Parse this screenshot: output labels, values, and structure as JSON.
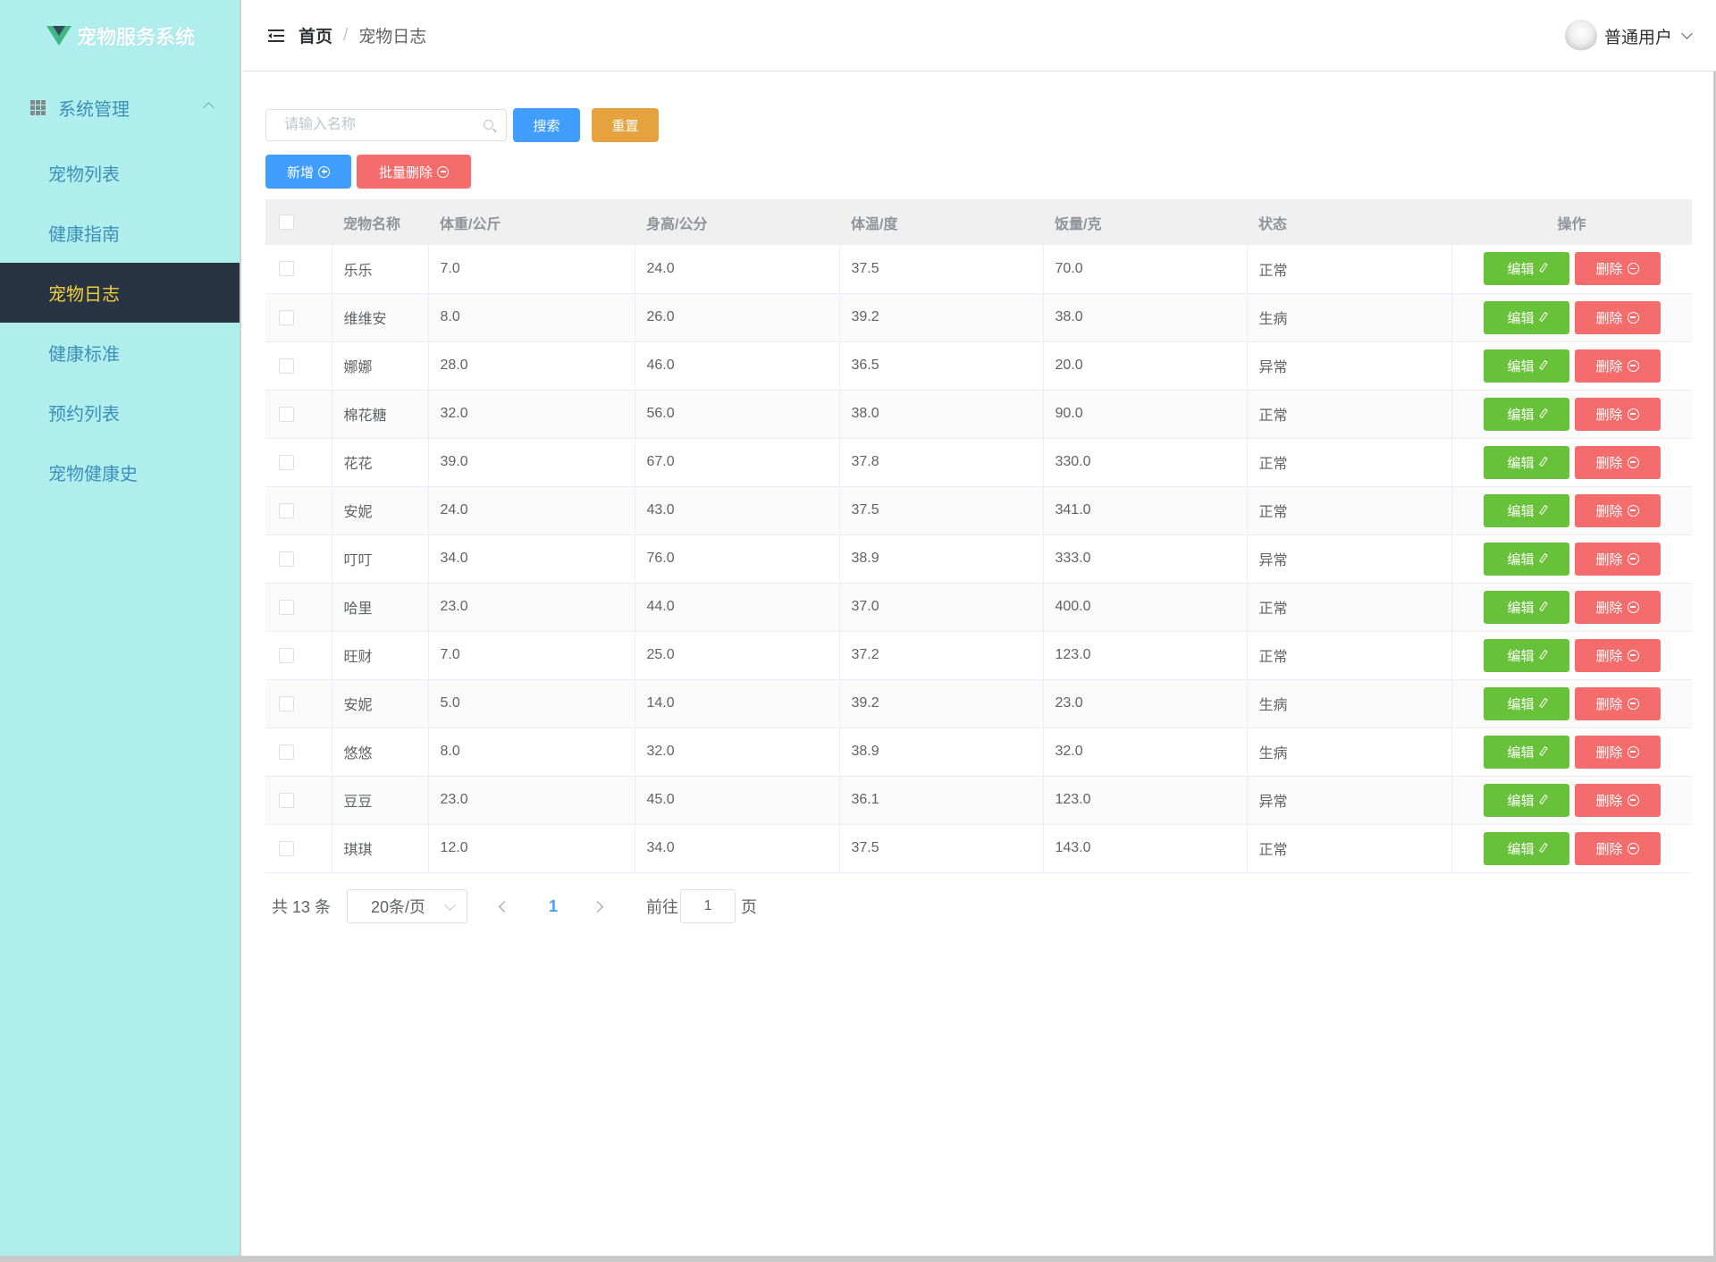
{
  "app": {
    "title": "宠物服务系统"
  },
  "sidebar": {
    "group_label": "系统管理",
    "items": [
      {
        "label": "宠物列表"
      },
      {
        "label": "健康指南"
      },
      {
        "label": "宠物日志"
      },
      {
        "label": "健康标准"
      },
      {
        "label": "预约列表"
      },
      {
        "label": "宠物健康史"
      }
    ],
    "active_index": 2
  },
  "header": {
    "breadcrumb": {
      "home": "首页",
      "separator": "/",
      "current": "宠物日志"
    },
    "user": {
      "name": "普通用户"
    }
  },
  "toolbar": {
    "search_placeholder": "请输入名称",
    "search_label": "搜索",
    "reset_label": "重置",
    "add_label": "新增",
    "batch_delete_label": "批量删除"
  },
  "table": {
    "columns": [
      "宠物名称",
      "体重/公斤",
      "身高/公分",
      "体温/度",
      "饭量/克",
      "状态",
      "操作"
    ],
    "edit_label": "编辑",
    "delete_label": "删除",
    "rows": [
      {
        "name": "乐乐",
        "weight": "7.0",
        "height": "24.0",
        "temp": "37.5",
        "food": "70.0",
        "status": "正常"
      },
      {
        "name": "维维安",
        "weight": "8.0",
        "height": "26.0",
        "temp": "39.2",
        "food": "38.0",
        "status": "生病"
      },
      {
        "name": "娜娜",
        "weight": "28.0",
        "height": "46.0",
        "temp": "36.5",
        "food": "20.0",
        "status": "异常"
      },
      {
        "name": "棉花糖",
        "weight": "32.0",
        "height": "56.0",
        "temp": "38.0",
        "food": "90.0",
        "status": "正常"
      },
      {
        "name": "花花",
        "weight": "39.0",
        "height": "67.0",
        "temp": "37.8",
        "food": "330.0",
        "status": "正常"
      },
      {
        "name": "安妮",
        "weight": "24.0",
        "height": "43.0",
        "temp": "37.5",
        "food": "341.0",
        "status": "正常"
      },
      {
        "name": "叮叮",
        "weight": "34.0",
        "height": "76.0",
        "temp": "38.9",
        "food": "333.0",
        "status": "异常"
      },
      {
        "name": "哈里",
        "weight": "23.0",
        "height": "44.0",
        "temp": "37.0",
        "food": "400.0",
        "status": "正常"
      },
      {
        "name": "旺财",
        "weight": "7.0",
        "height": "25.0",
        "temp": "37.2",
        "food": "123.0",
        "status": "正常"
      },
      {
        "name": "安妮",
        "weight": "5.0",
        "height": "14.0",
        "temp": "39.2",
        "food": "23.0",
        "status": "生病"
      },
      {
        "name": "悠悠",
        "weight": "8.0",
        "height": "32.0",
        "temp": "38.9",
        "food": "32.0",
        "status": "生病"
      },
      {
        "name": "豆豆",
        "weight": "23.0",
        "height": "45.0",
        "temp": "36.1",
        "food": "123.0",
        "status": "异常"
      },
      {
        "name": "琪琪",
        "weight": "12.0",
        "height": "34.0",
        "temp": "37.5",
        "food": "143.0",
        "status": "正常"
      }
    ]
  },
  "pagination": {
    "total_text": "共 13 条",
    "page_size": "20条/页",
    "current_page": "1",
    "goto_label": "前往",
    "goto_value": "1",
    "page_suffix": "页"
  },
  "colors": {
    "sidebar_bg": "#b0eeee",
    "active_bg": "#283443",
    "active_text": "#f4d03f",
    "primary": "#409eff",
    "warning": "#e6a23c",
    "danger": "#f56c6c",
    "success": "#67c23a"
  }
}
